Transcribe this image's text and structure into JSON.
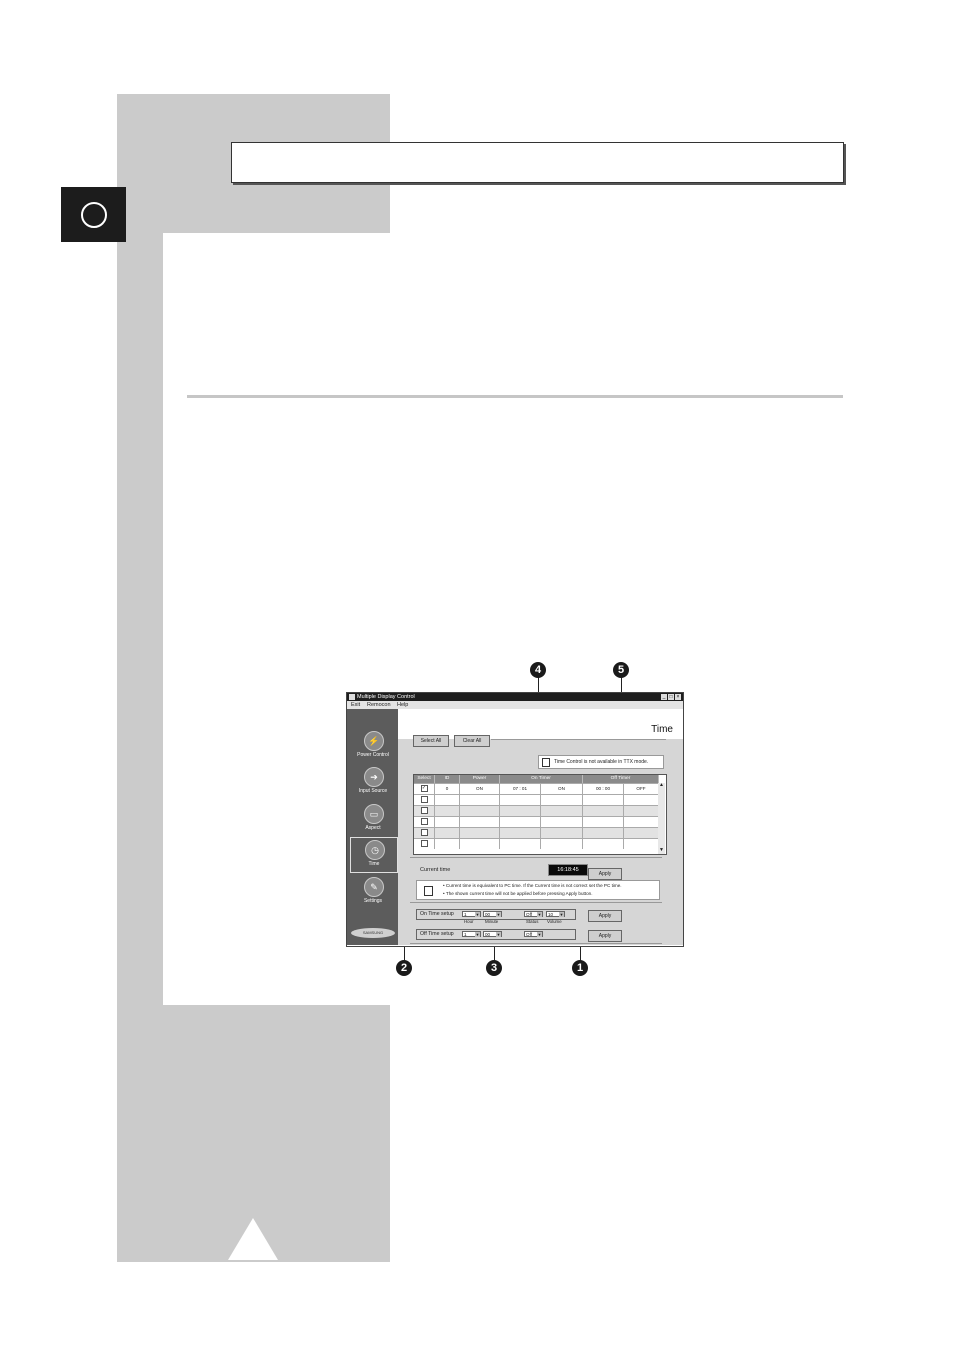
{
  "page": {
    "callouts": [
      "1",
      "2",
      "3",
      "4",
      "5"
    ]
  },
  "app": {
    "title": "Multiple Display Control",
    "menu": [
      "Exit",
      "Remocon",
      "Help"
    ],
    "window_buttons": [
      "_",
      "□",
      "×"
    ],
    "heading": "Time",
    "nav": [
      {
        "label": "Power Control",
        "icon": "power-control-icon"
      },
      {
        "label": "Input Source",
        "icon": "input-source-icon"
      },
      {
        "label": "Aspect",
        "icon": "aspect-icon"
      },
      {
        "label": "Time",
        "icon": "time-icon"
      },
      {
        "label": "Settings",
        "icon": "settings-icon"
      }
    ],
    "logo_text": "SAMSUNG",
    "select_all": "Select All",
    "clear_all": "Clear All",
    "notice": "Time Control is not available in TTX mode.",
    "table": {
      "headers": [
        "Select",
        "ID",
        "Power",
        "On Timer",
        "Off Timer"
      ],
      "rows": [
        {
          "checked": "✓",
          "id": "0",
          "power": "ON",
          "on_time": "07 : 01",
          "on_status": "ON",
          "off_time": "00 : 00",
          "off_status": "OFF"
        },
        {
          "checked": "",
          "id": "",
          "power": "",
          "on_time": "",
          "on_status": "",
          "off_time": "",
          "off_status": ""
        },
        {
          "checked": "",
          "id": "",
          "power": "",
          "on_time": "",
          "on_status": "",
          "off_time": "",
          "off_status": ""
        },
        {
          "checked": "",
          "id": "",
          "power": "",
          "on_time": "",
          "on_status": "",
          "off_time": "",
          "off_status": ""
        },
        {
          "checked": "",
          "id": "",
          "power": "",
          "on_time": "",
          "on_status": "",
          "off_time": "",
          "off_status": ""
        },
        {
          "checked": "",
          "id": "",
          "power": "",
          "on_time": "",
          "on_status": "",
          "off_time": "",
          "off_status": ""
        }
      ]
    },
    "current_time_label": "Current time",
    "current_time_value": "16:18:45",
    "apply": "Apply",
    "notes": [
      "Current time is equivalent to PC time. If the Current time is not correct set the PC time.",
      "The shown current time will not be applied before pressing Apply button."
    ],
    "on_setup": {
      "label": "On Time setup",
      "hour": "1",
      "minute": "00",
      "status": "Off",
      "volume": "10"
    },
    "off_setup": {
      "label": "Off Time setup",
      "hour": "1",
      "minute": "00",
      "status": "Off"
    },
    "sublabels": {
      "hour": "Hour",
      "minute": "Minute",
      "status": "Status",
      "volume": "Volume"
    }
  }
}
